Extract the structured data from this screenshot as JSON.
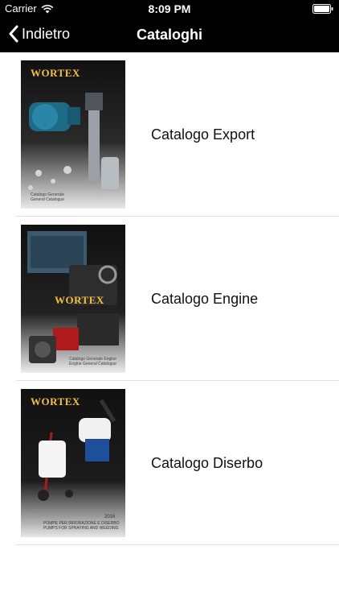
{
  "status_bar": {
    "carrier": "Carrier",
    "time": "8:09 PM"
  },
  "nav": {
    "back_label": "Indietro",
    "title": "Cataloghi"
  },
  "catalogs": [
    {
      "label": "Catalogo Export",
      "cover": {
        "brand": "WORTEX",
        "line1": "Catalogo Generale",
        "line2": "General Catalogue"
      }
    },
    {
      "label": "Catalogo Engine",
      "cover": {
        "brand": "WORTEX",
        "line1": "Catalogo Generale Engine",
        "line2": "Engine General Catalogue"
      }
    },
    {
      "label": "Catalogo Diserbo",
      "cover": {
        "brand": "WORTEX",
        "year": "2016",
        "line1": "POMPE PER IRRORAZIONE E DISERBO",
        "line2": "PUMPS FOR SPRAYING AND WEEDING"
      }
    }
  ]
}
